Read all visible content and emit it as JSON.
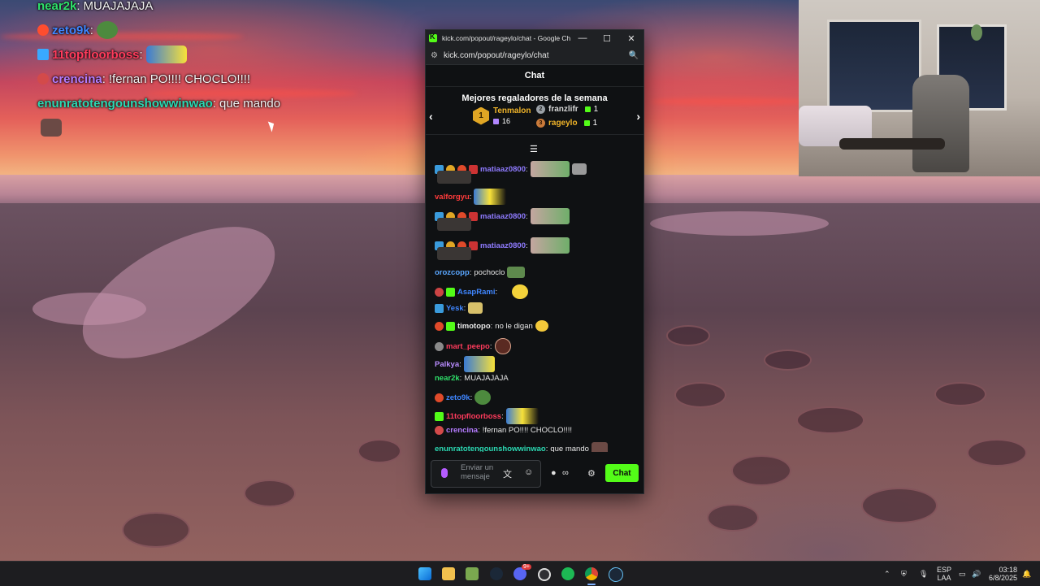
{
  "overlay_chat": [
    {
      "user": "near2k",
      "sep": ":",
      "text": "MUAJAJAJA",
      "color": "#2fe06a"
    },
    {
      "user": "zeto9k",
      "sep": ":",
      "text": "",
      "color": "#3f86ff"
    },
    {
      "user": "11topfloorboss",
      "sep": ":",
      "text": "",
      "color": "#ff3b5c"
    },
    {
      "user": "crencina",
      "sep": ":",
      "text": "!fernan PO!!!! CHOCLO!!!!",
      "color": "#b57cff"
    },
    {
      "user": "enunratotengounshowwinwao",
      "sep": ":",
      "text": "que mando",
      "color": "#2bd9b3"
    }
  ],
  "browser": {
    "title": "kick.com/popout/rageylo/chat - Google Ch...",
    "url": "kick.com/popout/rageylo/chat",
    "min_label": "—",
    "max_label": "☐",
    "close_label": "✕"
  },
  "chat": {
    "header": "Chat",
    "gifters_title": "Mejores regaladores de la semana",
    "top_gifter": {
      "rank": "1",
      "name": "Tenmalon",
      "count": "16"
    },
    "others": [
      {
        "rank": "2",
        "name": "franzlifr",
        "count": "1"
      },
      {
        "rank": "3",
        "name": "rageylo",
        "count": "1"
      }
    ],
    "messages": [
      {
        "user": "matiaaz0800",
        "sep": ":",
        "text": "",
        "color": "#8f7bff"
      },
      {
        "user": "valforgyu",
        "sep": ":",
        "text": "",
        "color": "#ff3b3b"
      },
      {
        "user": "matiaaz0800",
        "sep": ":",
        "text": "",
        "color": "#8f7bff"
      },
      {
        "user": "matiaaz0800",
        "sep": ":",
        "text": "",
        "color": "#8f7bff"
      },
      {
        "user": "orozcopp",
        "sep": ":",
        "text": "pochoclo",
        "color": "#5aa7ff"
      },
      {
        "user": "AsapRami",
        "sep": ":",
        "text": "",
        "color": "#3f86ff"
      },
      {
        "user": "Yesk",
        "sep": ":",
        "text": "",
        "color": "#3f86ff"
      },
      {
        "user": "timotopo",
        "sep": ":",
        "text": "no le digan",
        "color": "#e8e8e8"
      },
      {
        "user": "mart_peepo",
        "sep": ":",
        "text": "",
        "color": "#ff3b5c"
      },
      {
        "user": "Palkya",
        "sep": ":",
        "text": "",
        "color": "#b98cff"
      },
      {
        "user": "near2k",
        "sep": ":",
        "text": "MUAJAJAJA",
        "color": "#2fe06a"
      },
      {
        "user": "zeto9k",
        "sep": ":",
        "text": "",
        "color": "#3f86ff"
      },
      {
        "user": "11topfloorboss",
        "sep": ":",
        "text": "",
        "color": "#ff3b5c"
      },
      {
        "user": "crencina",
        "sep": ":",
        "text": "!fernan PO!!!! CHOCLO!!!!",
        "color": "#b57cff"
      },
      {
        "user": "enunratotengounshowwinwao",
        "sep": ":",
        "text": "que mando",
        "color": "#2bd9b3"
      }
    ],
    "composer_placeholder": "Enviar un mensaje",
    "send_label": "Chat",
    "accent": "#53fc18"
  },
  "taskbar": {
    "language": "ESP",
    "layout": "LAA",
    "time": "03:18",
    "date": "6/8/2025",
    "discord_badge": "9+"
  }
}
